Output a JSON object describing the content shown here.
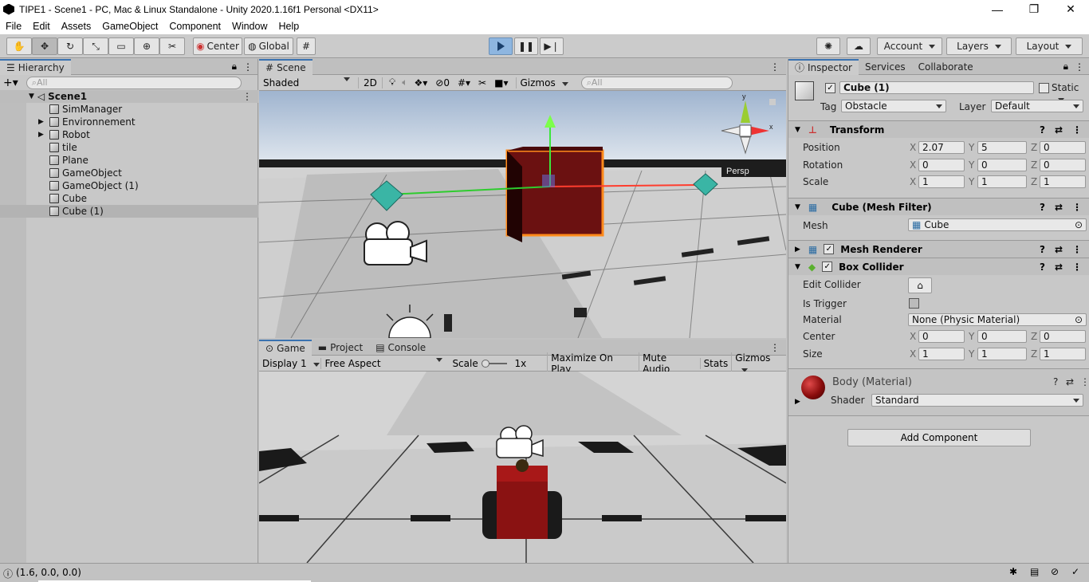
{
  "window": {
    "title": "TIPE1 - Scene1 - PC, Mac & Linux Standalone - Unity 2020.1.16f1 Personal <DX11>",
    "minimize": "—",
    "maximize": "❐",
    "close": "✕"
  },
  "menu": [
    "File",
    "Edit",
    "Assets",
    "GameObject",
    "Component",
    "Window",
    "Help"
  ],
  "toolbar": {
    "pivot": "Center",
    "space": "Global",
    "account": "Account",
    "layers": "Layers",
    "layout": "Layout"
  },
  "hierarchy": {
    "tab": "Hierarchy",
    "search_placeholder": "All",
    "scene": "Scene1",
    "items": [
      "SimManager",
      "Environnement",
      "Robot",
      "tile",
      "Plane",
      "GameObject",
      "GameObject (1)",
      "Cube",
      "Cube (1)"
    ]
  },
  "scene_view": {
    "tab": "Scene",
    "shading": "Shaded",
    "mode_2d": "2D",
    "gizmos": "Gizmos",
    "search_placeholder": "All",
    "effects_count": "0",
    "persp": "Persp"
  },
  "game_view": {
    "tabs": [
      "Game",
      "Project",
      "Console"
    ],
    "display": "Display 1",
    "aspect": "Free Aspect",
    "scale_label": "Scale",
    "scale_value": "1x",
    "maximize": "Maximize On Play",
    "mute": "Mute Audio",
    "stats": "Stats",
    "gizmos": "Gizmos"
  },
  "inspector": {
    "tabs": [
      "Inspector",
      "Services",
      "Collaborate"
    ],
    "object_name": "Cube (1)",
    "static_label": "Static",
    "tag_label": "Tag",
    "tag_value": "Obstacle",
    "layer_label": "Layer",
    "layer_value": "Default",
    "transform": {
      "title": "Transform",
      "position_label": "Position",
      "rotation_label": "Rotation",
      "scale_label": "Scale",
      "position": [
        "2.07",
        "5",
        "0"
      ],
      "rotation": [
        "0",
        "0",
        "0"
      ],
      "scale": [
        "1",
        "1",
        "1"
      ]
    },
    "mesh_filter": {
      "title": "Cube (Mesh Filter)",
      "mesh_label": "Mesh",
      "mesh_value": "Cube"
    },
    "mesh_renderer": {
      "title": "Mesh Renderer"
    },
    "box_collider": {
      "title": "Box Collider",
      "edit_label": "Edit Collider",
      "trigger_label": "Is Trigger",
      "material_label": "Material",
      "material_value": "None (Physic Material)",
      "center_label": "Center",
      "size_label": "Size",
      "center": [
        "0",
        "0",
        "0"
      ],
      "size": [
        "1",
        "1",
        "1"
      ]
    },
    "material": {
      "title": "Body (Material)",
      "shader_label": "Shader",
      "shader_value": "Standard",
      "color": "#8a0c0c"
    },
    "add_component": "Add Component"
  },
  "status": {
    "text": "(1.6, 0.0, 0.0)"
  },
  "axis_letters": [
    "X",
    "Y",
    "Z"
  ]
}
